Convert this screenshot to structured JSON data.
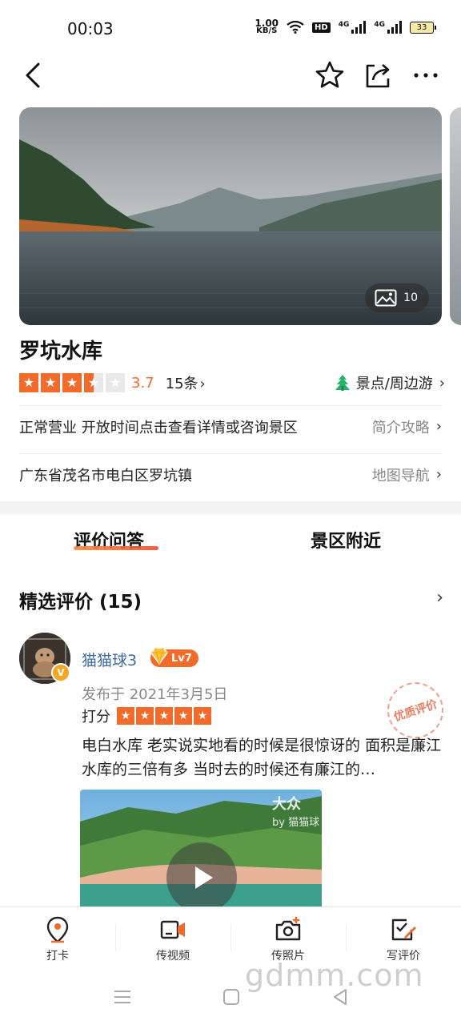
{
  "status_bar": {
    "time": "00:03",
    "net_speed_value": "1.00",
    "net_speed_unit": "KB/S",
    "hd_label": "HD",
    "signal1_label": "4G",
    "signal2_label": "4G",
    "battery": "33"
  },
  "nav": {
    "back_icon": "back-arrow",
    "favorite_icon": "star-outline",
    "share_icon": "share",
    "more_icon": "more-dots"
  },
  "hero": {
    "photo_count": "10",
    "photo_icon": "image"
  },
  "poi": {
    "title": "罗坑水库",
    "rating_value": 3.5,
    "rating_score": "3.7",
    "review_count": "15条",
    "category": "景点/周边游",
    "hours": "正常营业 开放时间点击查看详情或咨询景区",
    "hours_link": "简介攻略",
    "address": "广东省茂名市电白区罗坑镇",
    "address_link": "地图导航"
  },
  "tabs": [
    {
      "label": "评价问答",
      "active": true
    },
    {
      "label": "景区附近",
      "active": false
    }
  ],
  "reviews_section": {
    "title": "精选评价 (15)"
  },
  "review": {
    "username": "猫猫球3",
    "level": "Lv7",
    "verified_mark": "V",
    "date": "发布于 2021年3月5日",
    "score_label": "打分",
    "score_stars": 5,
    "stamp": "优质评价",
    "text": "电白水库 老实说实地看的时候是很惊讶的 面积是廉江水库的三倍有多 当时去的时候还有廉江的…",
    "video_watermark": "大众",
    "video_by": "by 猫猫球"
  },
  "bottom_bar": [
    {
      "label": "打卡",
      "icon": "location-pin"
    },
    {
      "label": "传视频",
      "icon": "video-camera"
    },
    {
      "label": "传照片",
      "icon": "photo-camera-plus"
    },
    {
      "label": "写评价",
      "icon": "edit-review"
    }
  ],
  "watermark": "gdmm.com",
  "colors": {
    "accent": "#f26b2b",
    "link_blue": "#3f6aa0",
    "muted": "#888888"
  }
}
